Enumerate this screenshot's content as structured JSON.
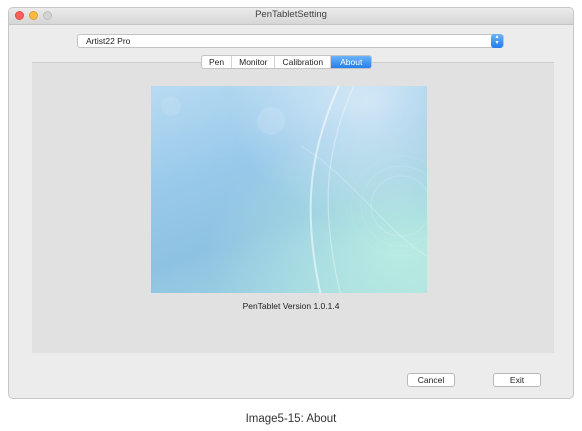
{
  "window": {
    "title": "PenTabletSetting"
  },
  "device_select": {
    "value": "Artist22 Pro"
  },
  "tabs": [
    {
      "label": "Pen"
    },
    {
      "label": "Monitor"
    },
    {
      "label": "Calibration"
    },
    {
      "label": "About"
    }
  ],
  "active_tab": "About",
  "about": {
    "version_text": "PenTablet Version  1.0.1.4"
  },
  "buttons": {
    "cancel": "Cancel",
    "exit": "Exit"
  },
  "caption": "Image5-15: About",
  "colors": {
    "accent": "#2380ec",
    "window_bg": "#ececec",
    "panel_bg": "#e1e1e1"
  }
}
